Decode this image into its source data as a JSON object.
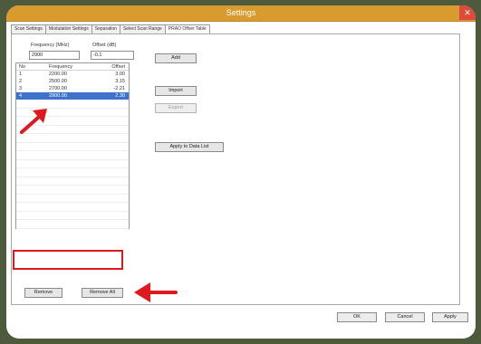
{
  "window": {
    "title": "Settings",
    "close_glyph": "✕"
  },
  "tabs": [
    {
      "label": "Scan Settings",
      "active": false
    },
    {
      "label": "Modulation Settings",
      "active": false
    },
    {
      "label": "Separation",
      "active": false
    },
    {
      "label": "Select Scan Range",
      "active": false
    },
    {
      "label": "PRAO Offset Table",
      "active": true
    }
  ],
  "form": {
    "frequency_label": "Frequency (MHz)",
    "frequency_value": "2900",
    "offset_label": "Offset (dB)",
    "offset_value": "-0.1"
  },
  "table": {
    "headers": {
      "no": "No",
      "frequency": "Frequency",
      "offset": "Offset"
    },
    "rows": [
      {
        "no": "1",
        "frequency": "2200.00",
        "offset": "3.00",
        "selected": false
      },
      {
        "no": "2",
        "frequency": "2500.00",
        "offset": "3.15",
        "selected": false
      },
      {
        "no": "3",
        "frequency": "2700.00",
        "offset": "-2.21",
        "selected": false
      },
      {
        "no": "4",
        "frequency": "2900.00",
        "offset": "2.30",
        "selected": true
      }
    ]
  },
  "buttons": {
    "add": "Add",
    "import": "Import",
    "export": "Export",
    "apply_to_data_list": "Apply to Data List",
    "remove": "Remove",
    "remove_all": "Remove All"
  },
  "footer": {
    "ok": "OK",
    "cancel": "Cancel",
    "apply": "Apply"
  },
  "colors": {
    "titlebar": "#d99a2e",
    "selection": "#3e73c9",
    "annotation_red": "#e0191e",
    "background": "#4e5a3c"
  }
}
